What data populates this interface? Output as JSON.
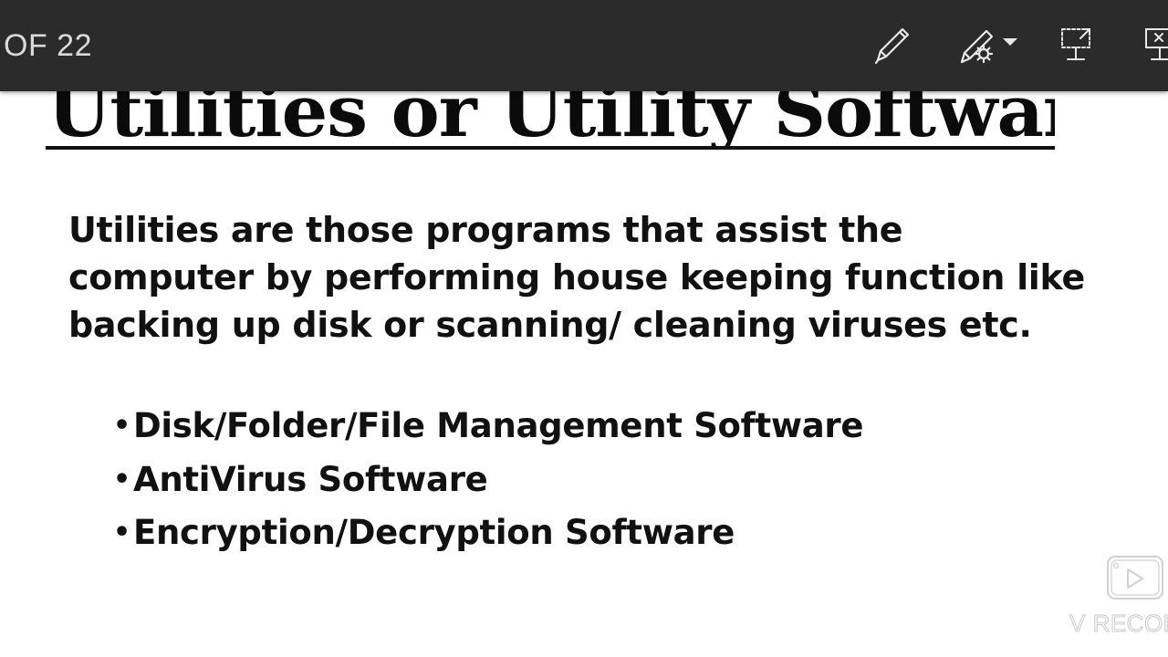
{
  "toolbar": {
    "slide_counter": "OF 22",
    "background": "#2b2b2b",
    "tools": [
      {
        "name": "pen-tool",
        "icon": "pen-icon"
      },
      {
        "name": "laser-pointer-tool",
        "icon": "laser-pen-settings-icon"
      },
      {
        "name": "dropdown-arrow",
        "icon": "caret-down-icon"
      },
      {
        "name": "presenter-view",
        "icon": "presentation-screen-icon"
      },
      {
        "name": "end-show",
        "icon": "close-presentation-icon"
      }
    ]
  },
  "slide": {
    "title": "Utilities or Utility Software",
    "paragraph": "Utilities are those programs that assist the computer by performing house keeping function like backing up disk or scanning/ cleaning viruses etc.",
    "bullets": [
      "Disk/Folder/File Management Software",
      "AntiVirus Software",
      "Encryption/Decryption Software"
    ]
  },
  "watermark": {
    "text": "V RECOR",
    "icon": "play-video-icon"
  }
}
